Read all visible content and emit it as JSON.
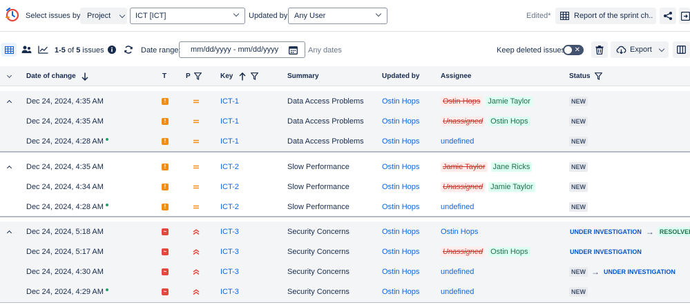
{
  "header": {
    "select_issues_label": "Select issues by:",
    "project_button": "Project",
    "project_value": "ICT [ICT]",
    "updated_by_label": "Updated by:",
    "updated_by_value": "Any User",
    "edited_label": "Edited*",
    "report_button": "Report of the sprint ch..."
  },
  "toolbar": {
    "range_start": "1-5",
    "of_label": "of",
    "total": "5",
    "issues_label": "issues",
    "date_range_label": "Date range:",
    "date_placeholder": "mm/dd/yyyy - mm/dd/yyyy",
    "any_dates": "Any dates",
    "keep_deleted_label": "Keep deleted issues",
    "export_button": "Export"
  },
  "columns": {
    "date": "Date of change",
    "type": "T",
    "priority": "P",
    "key": "Key",
    "summary": "Summary",
    "updated_by": "Updated by",
    "assignee": "Assignee",
    "status": "Status"
  },
  "groups": [
    {
      "rows": [
        {
          "date": "Dec 24, 2024, 4:35 AM",
          "type": "task",
          "priority": "medium",
          "key": "ICT-1",
          "summary": "Data Access Problems",
          "updated_by": "Ostin Hops",
          "assignee_old": "Ostin Hops",
          "assignee_new": "Jamie Taylor",
          "status": "NEW"
        },
        {
          "date": "Dec 24, 2024, 4:35 AM",
          "type": "task",
          "priority": "medium",
          "key": "ICT-1",
          "summary": "Data Access Problems",
          "updated_by": "Ostin Hops",
          "assignee_old": "Unassigned",
          "assignee_new": "Ostin Hops",
          "status": "NEW"
        },
        {
          "date": "Dec 24, 2024, 4:28 AM",
          "type": "task",
          "priority": "medium",
          "key": "ICT-1",
          "summary": "Data Access Problems",
          "updated_by": "Ostin Hops",
          "assignee_plain": "undefined",
          "status": "NEW",
          "dot": true
        }
      ]
    },
    {
      "rows": [
        {
          "date": "Dec 24, 2024, 4:35 AM",
          "type": "task",
          "priority": "medium",
          "key": "ICT-2",
          "summary": "Slow Performance",
          "updated_by": "Ostin Hops",
          "assignee_old": "Jamie Taylor",
          "assignee_new": "Jane Ricks",
          "status": "NEW"
        },
        {
          "date": "Dec 24, 2024, 4:34 AM",
          "type": "task",
          "priority": "medium",
          "key": "ICT-2",
          "summary": "Slow Performance",
          "updated_by": "Ostin Hops",
          "assignee_old": "Unassigned",
          "assignee_new": "Jamie Taylor",
          "status": "NEW"
        },
        {
          "date": "Dec 24, 2024, 4:28 AM",
          "type": "task",
          "priority": "medium",
          "key": "ICT-2",
          "summary": "Slow Performance",
          "updated_by": "Ostin Hops",
          "assignee_plain": "undefined",
          "status": "NEW",
          "dot": true
        }
      ]
    },
    {
      "rows": [
        {
          "date": "Dec 24, 2024, 5:18 AM",
          "type": "bug",
          "priority": "high",
          "key": "ICT-3",
          "summary": "Security Concerns",
          "updated_by": "Ostin Hops",
          "assignee_link": "Ostin Hops",
          "status_old": "UNDER INVESTIGATION",
          "status_new": "RESOLVED"
        },
        {
          "date": "Dec 24, 2024, 5:17 AM",
          "type": "bug",
          "priority": "high",
          "key": "ICT-3",
          "summary": "Security Concerns",
          "updated_by": "Ostin Hops",
          "assignee_old": "Unassigned",
          "assignee_new": "Ostin Hops",
          "status_blue": "UNDER INVESTIGATION"
        },
        {
          "date": "Dec 24, 2024, 4:30 AM",
          "type": "bug",
          "priority": "high",
          "key": "ICT-3",
          "summary": "Security Concerns",
          "updated_by": "Ostin Hops",
          "assignee_plain": "undefined",
          "status_old_new": "NEW",
          "status_new_blue": "UNDER INVESTIGATION"
        },
        {
          "date": "Dec 24, 2024, 4:29 AM",
          "type": "bug",
          "priority": "high",
          "key": "ICT-3",
          "summary": "Security Concerns",
          "updated_by": "Ostin Hops",
          "assignee_plain": "undefined",
          "status": "NEW",
          "dot": true
        }
      ]
    }
  ],
  "colors": {
    "accent": "#0c66e4",
    "task": "#f18d13",
    "bug": "#e2483d",
    "priority_medium": "#f18d13",
    "priority_high": "#e2483d"
  },
  "icons": [
    "app-logo-icon",
    "table-view-icon",
    "users-icon",
    "chart-icon",
    "info-icon",
    "refresh-icon",
    "calendar-icon",
    "trash-icon",
    "cloud-download-icon",
    "columns-icon",
    "share-icon",
    "exit-icon",
    "table-icon",
    "filter-icon",
    "sort-down-icon",
    "sort-up-icon"
  ]
}
